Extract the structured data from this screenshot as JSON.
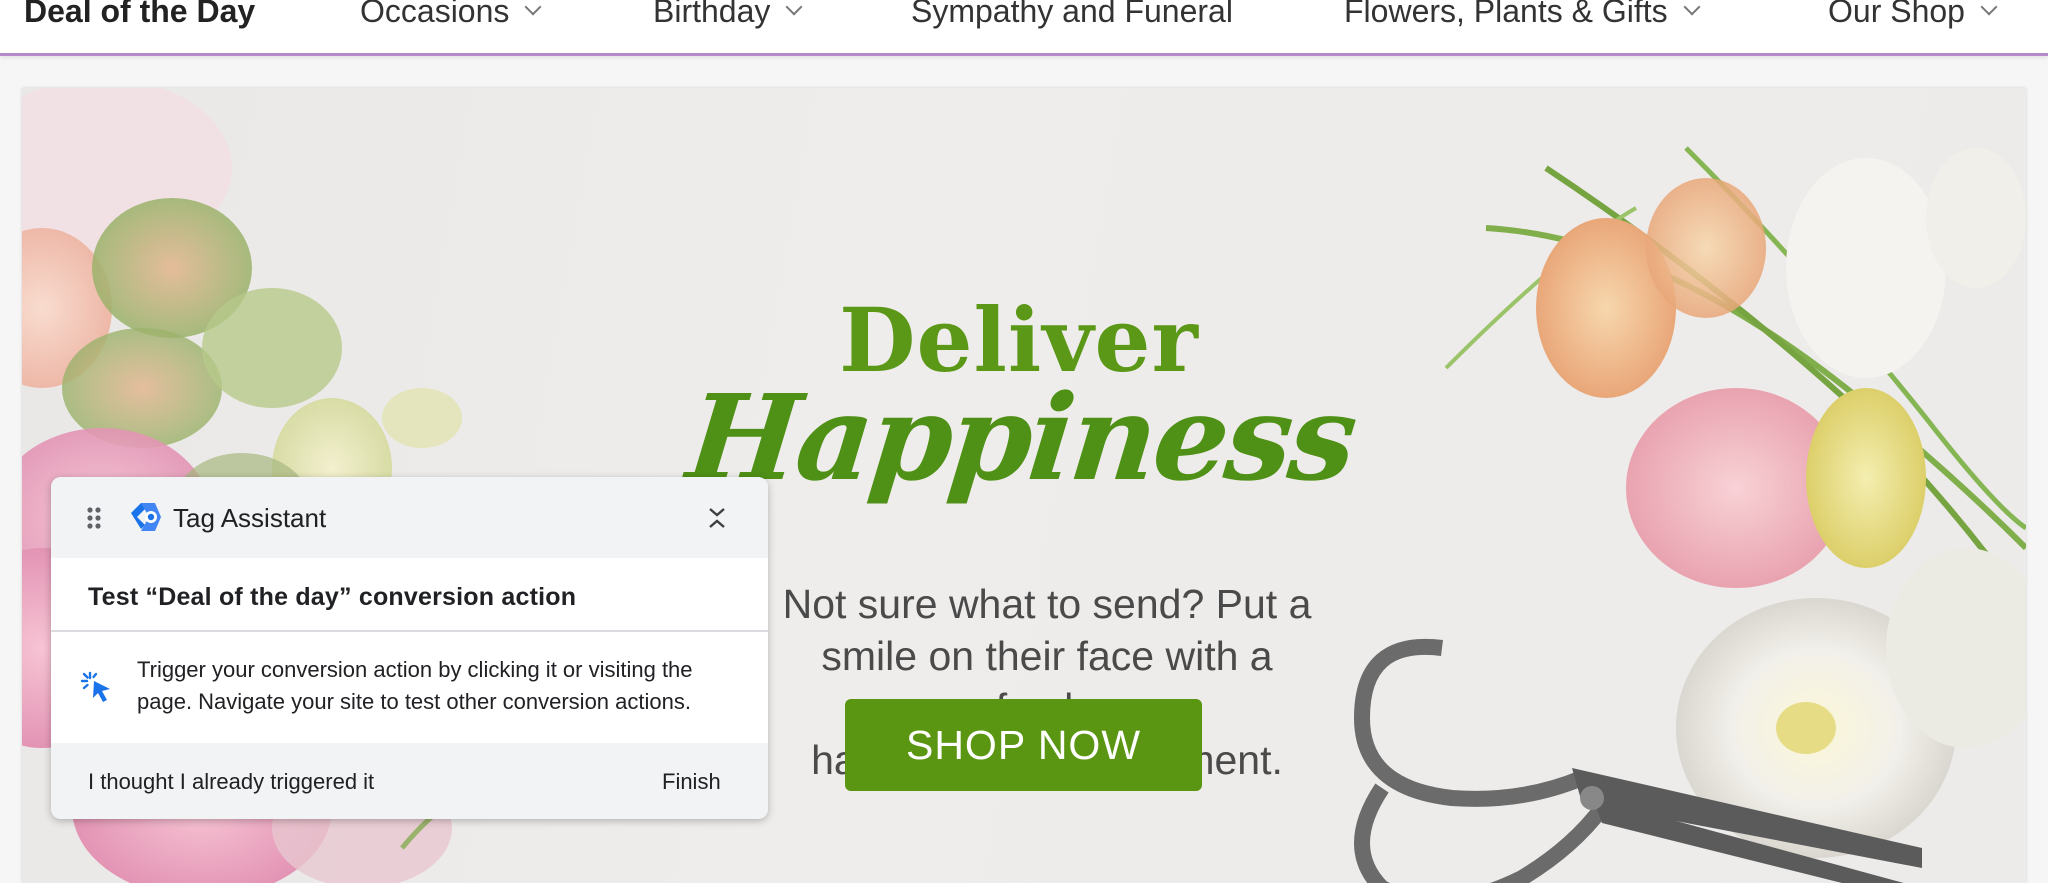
{
  "nav": {
    "items": [
      {
        "label": "Deal of the Day",
        "has_dropdown": false
      },
      {
        "label": "Occasions",
        "has_dropdown": true
      },
      {
        "label": "Birthday",
        "has_dropdown": true
      },
      {
        "label": "Sympathy and Funeral",
        "has_dropdown": false
      },
      {
        "label": "Flowers, Plants & Gifts",
        "has_dropdown": true
      },
      {
        "label": "Our Shop",
        "has_dropdown": true
      }
    ],
    "accent_color": "#b48ac9"
  },
  "hero": {
    "title_line1": "Deliver",
    "title_line2": "Happiness",
    "text_line1": "Not sure what to send? Put a",
    "text_line2": "smile on their face with a fresh,",
    "text_line3": "handcrafted arrangement.",
    "button_label": "SHOP NOW",
    "brand_color": "#5b9613"
  },
  "tag_assistant": {
    "title": "Tag Assistant",
    "heading": "Test “Deal of the day” conversion action",
    "body_line1": "Trigger your conversion action by clicking it or visiting the",
    "body_line2": "page. Navigate your site to test other conversion actions.",
    "link_label": "I thought I already triggered it",
    "finish_label": "Finish",
    "icons": {
      "drag": "drag-handle-icon",
      "logo": "tag-assistant-logo-icon",
      "collapse": "collapse-icon",
      "click": "cursor-click-icon"
    }
  }
}
